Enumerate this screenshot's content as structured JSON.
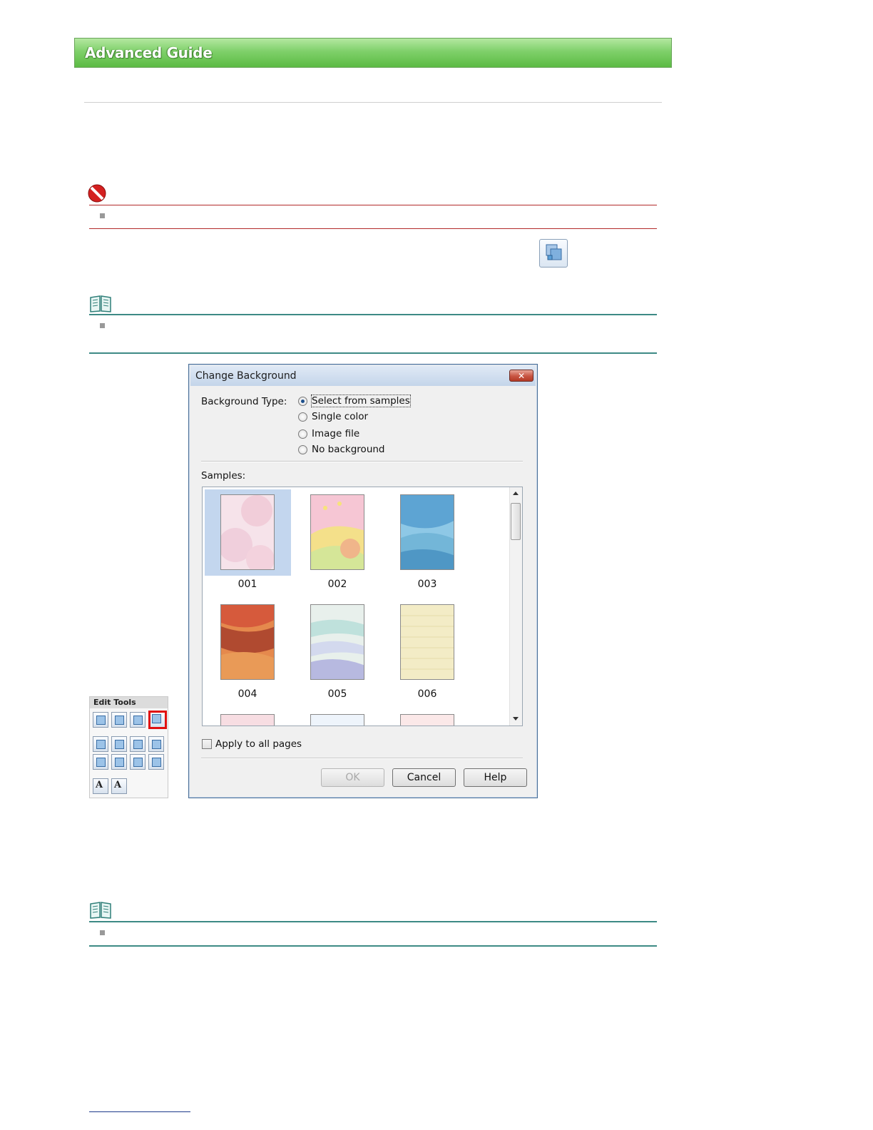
{
  "banner": {
    "title": "Advanced Guide"
  },
  "dialog": {
    "title": "Change Background",
    "close_label": "✕",
    "background_type_label": "Background Type:",
    "options": [
      {
        "label": "Select from samples",
        "selected": true
      },
      {
        "label": "Single color",
        "selected": false
      },
      {
        "label": "Image file",
        "selected": false
      },
      {
        "label": "No background",
        "selected": false
      }
    ],
    "samples_label": "Samples:",
    "samples": [
      {
        "label": "001",
        "selected": true
      },
      {
        "label": "002",
        "selected": false
      },
      {
        "label": "003",
        "selected": false
      },
      {
        "label": "004",
        "selected": false
      },
      {
        "label": "005",
        "selected": false
      },
      {
        "label": "006",
        "selected": false
      }
    ],
    "apply_all_label": "Apply to all pages",
    "apply_all_checked": false,
    "buttons": {
      "ok": "OK",
      "cancel": "Cancel",
      "help": "Help"
    }
  },
  "edit_tools": {
    "label": "Edit  Tools",
    "text_tool_glyph": "A"
  },
  "colors": {
    "banner_green": "#6cc556",
    "caution_red": "#b22b2b",
    "note_teal": "#3d8a85",
    "selection_blue": "#c3d6ee",
    "highlight_red": "#e01010"
  },
  "icons": [
    "caution-icon",
    "note-icon",
    "background-tool-icon",
    "close-icon"
  ]
}
